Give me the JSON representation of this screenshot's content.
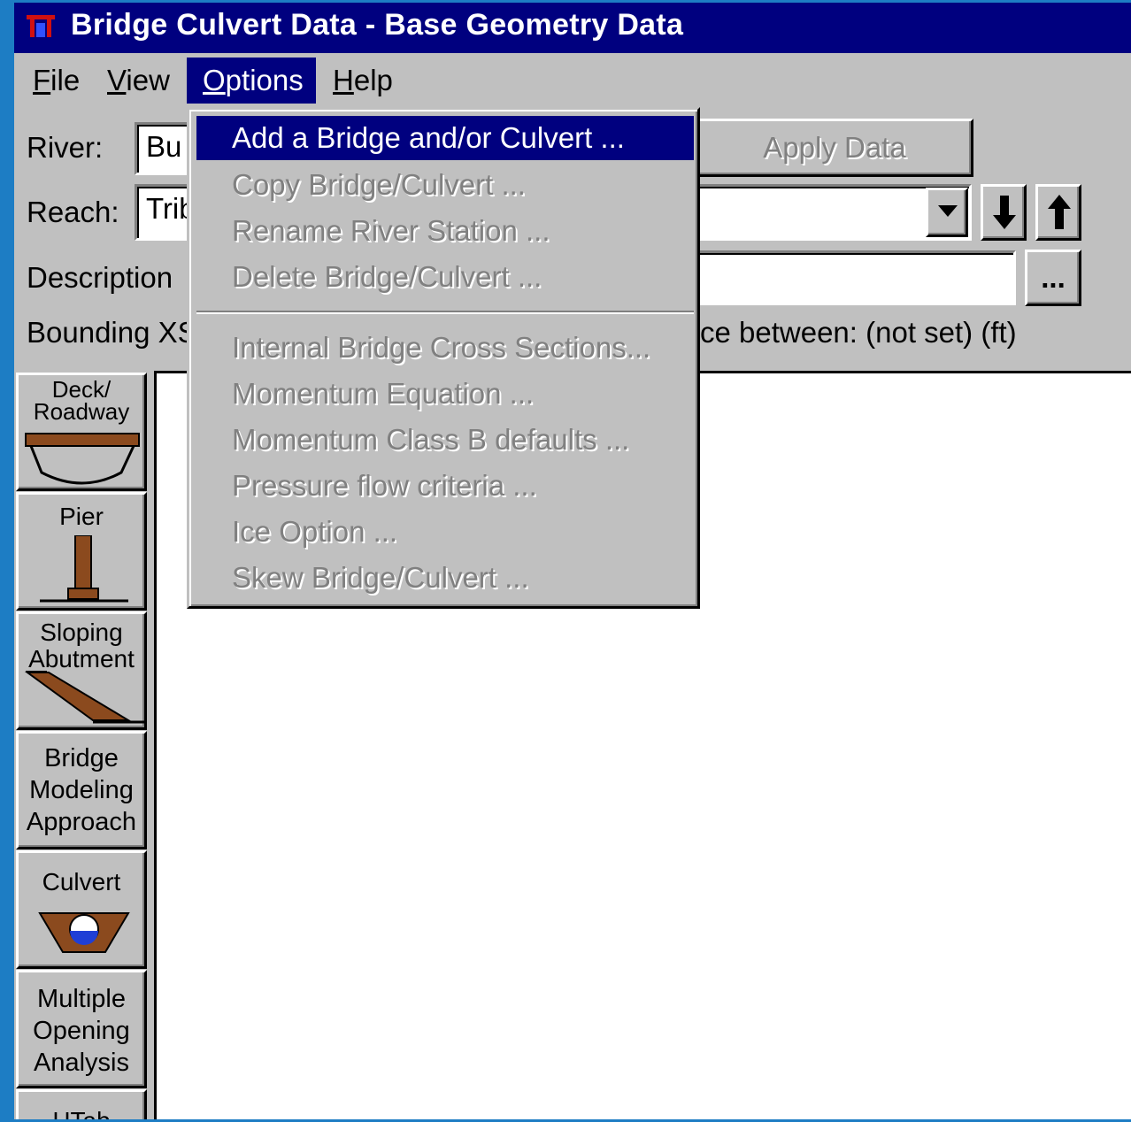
{
  "window": {
    "title": "Bridge Culvert Data - Base Geometry Data"
  },
  "menubar": {
    "file": "File",
    "view": "View",
    "options": "Options",
    "help": "Help"
  },
  "form": {
    "river_label": "River:",
    "river_value": "Bu",
    "reach_label": "Reach:",
    "reach_value": "Trib",
    "description_label": "Description",
    "description_button": "...",
    "bounding_label": "Bounding XS",
    "distance_text": "ce between: (not set) (ft)",
    "apply_button": "Apply Data"
  },
  "toolbox": {
    "deck": [
      "Deck/",
      "Roadway"
    ],
    "pier": "Pier",
    "sloping": [
      "Sloping",
      "Abutment"
    ],
    "approach": [
      "Bridge",
      "Modeling",
      "Approach"
    ],
    "culvert": "Culvert",
    "multiple": [
      "Multiple",
      "Opening",
      "Analysis"
    ],
    "htab": "HTab"
  },
  "options_menu": {
    "items": [
      {
        "label": "Add a Bridge and/or Culvert ...",
        "enabled": true,
        "highlighted": true
      },
      {
        "label": "Copy Bridge/Culvert ...",
        "enabled": false
      },
      {
        "label": "Rename River Station ...",
        "enabled": false
      },
      {
        "label": "Delete Bridge/Culvert ...",
        "enabled": false
      },
      {
        "label": "Internal Bridge Cross Sections...",
        "enabled": false
      },
      {
        "label": "Momentum Equation ...",
        "enabled": false
      },
      {
        "label": "Momentum Class B defaults ...",
        "enabled": false
      },
      {
        "label": "Pressure flow criteria ...",
        "enabled": false
      },
      {
        "label": "Ice Option ...",
        "enabled": false
      },
      {
        "label": "Skew Bridge/Culvert ...",
        "enabled": false
      }
    ]
  },
  "colors": {
    "titlebar": "#00007f",
    "desktop": "#1d7dc4",
    "face": "#c0c0c0",
    "earth": "#8b4a1e",
    "water": "#1f3fd6"
  }
}
